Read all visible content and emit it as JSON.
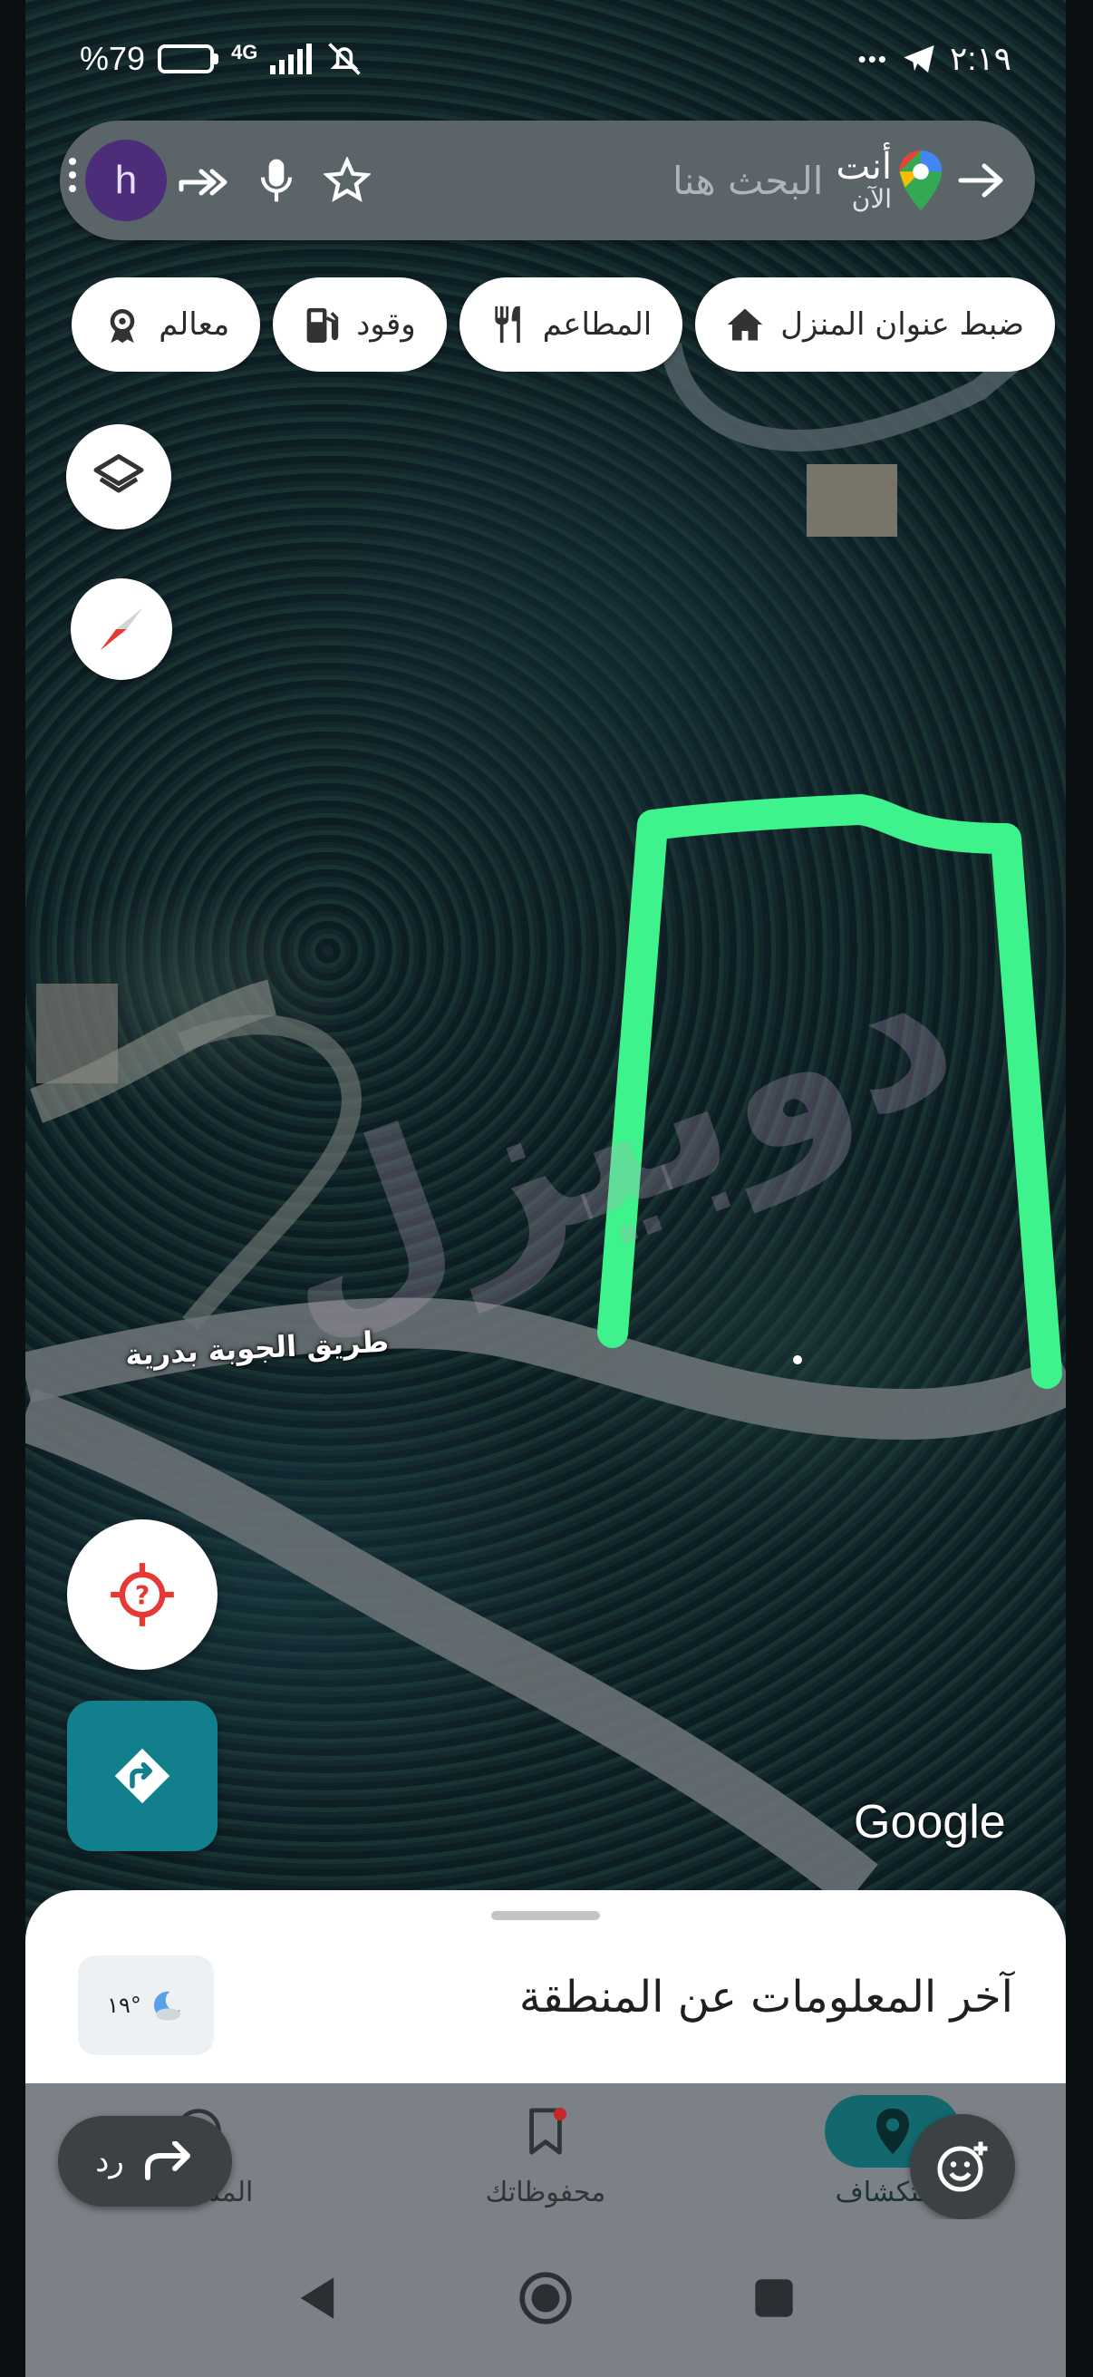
{
  "status_bar": {
    "time": "٢:١٩",
    "overflow": "•••",
    "battery": "%79",
    "battery_level": 0.79,
    "network": "4G"
  },
  "search": {
    "placeholder": "البحث هنا",
    "you_label": "أنت",
    "now_label": "الآن",
    "avatar_letter": "h"
  },
  "chips": [
    {
      "label": "ضبط عنوان المنزل",
      "icon": "home-icon"
    },
    {
      "label": "المطاعم",
      "icon": "restaurant-icon"
    },
    {
      "label": "وقود",
      "icon": "fuel-icon"
    },
    {
      "label": "معالم",
      "icon": "landmark-icon"
    }
  ],
  "map": {
    "road_label": "طريق الجوبة بدرية",
    "watermark": "دوبيزل",
    "attribution": "Google",
    "outline_color": "#3ef28c"
  },
  "sheet": {
    "title": "آخر المعلومات عن المنطقة",
    "weather": "١٩°"
  },
  "bottom_nav": [
    {
      "label": "استكشاف",
      "icon": "explore-pin-icon",
      "active": true
    },
    {
      "label": "محفوظاتك",
      "icon": "bookmark-icon",
      "active": false
    },
    {
      "label": "المساهمة",
      "icon": "contribute-icon",
      "active": false
    }
  ],
  "overlay": {
    "reply_label": "رد"
  },
  "colors": {
    "accent": "#12808c",
    "nav_active": "#13686e",
    "outline": "#3ef28c"
  }
}
